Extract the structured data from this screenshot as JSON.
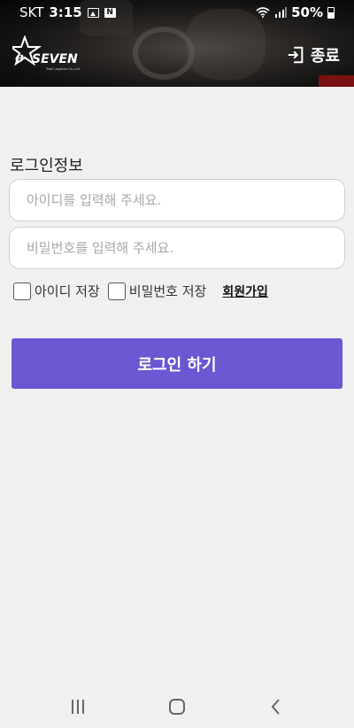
{
  "status_bar": {
    "carrier": "SKT",
    "time": "3:15",
    "notif_icons": [
      "image-icon",
      "n-app-icon"
    ],
    "battery": "50%"
  },
  "header": {
    "logo_text": "SEVEN",
    "logo_subtext": "Total Logistics Co.,Ltd",
    "exit_label": "종료",
    "accent_color": "#6a57d2"
  },
  "login": {
    "section_title": "로그인정보",
    "id_placeholder": "아이디를 입력해 주세요.",
    "id_value": "",
    "pw_placeholder": "비밀번호를 입력해 주세요.",
    "pw_value": "",
    "save_id_label": "아이디 저장",
    "save_id_checked": false,
    "save_pw_label": "비밀번호 저장",
    "save_pw_checked": false,
    "signup_label": "회원가입",
    "login_button_label": "로그인 하기"
  },
  "nav": {
    "icons": [
      "recent-apps-icon",
      "home-icon",
      "back-icon"
    ]
  }
}
